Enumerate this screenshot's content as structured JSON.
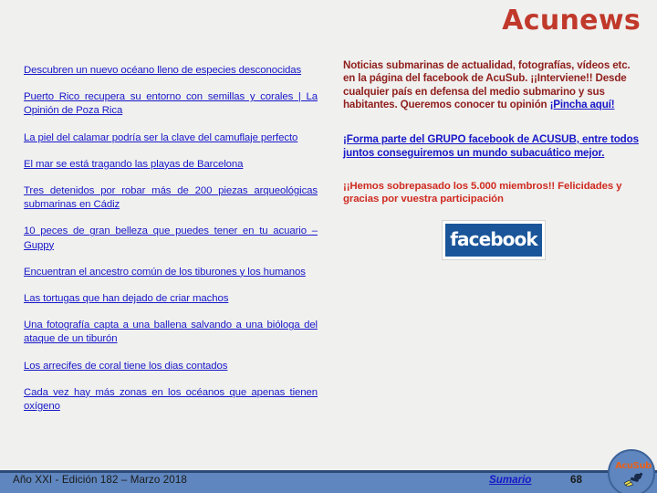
{
  "header": {
    "title": "Acunews",
    "title_color": "#c0392b"
  },
  "left_column": {
    "links": [
      {
        "text": "Descubren un nuevo océano lleno de especies desconocidas"
      },
      {
        "text": "Puerto Rico recupera su entorno con semillas y corales | La Opinión de Poza Rica"
      },
      {
        "text": "La piel del calamar podría ser la clave del camuflaje perfecto"
      },
      {
        "text": "El mar se está tragando las playas de Barcelona"
      },
      {
        "text": "Tres detenidos por robar más de 200 piezas arqueológicas submarinas en Cádiz"
      },
      {
        "text": "10 peces de gran belleza que puedes tener en tu acuario – Guppy"
      },
      {
        "text": "Encuentran el ancestro común de los tiburones y los humanos"
      },
      {
        "text": "Las tortugas que han dejado de criar machos"
      },
      {
        "text": "Una fotografía capta a una ballena salvando a una bióloga del ataque de un tiburón"
      },
      {
        "text": "Los arrecifes de coral tiene los dias contados"
      },
      {
        "text": "Cada vez hay más zonas en los océanos que apenas tienen oxígeno"
      }
    ],
    "link_color": "#1818c8"
  },
  "right_column": {
    "intro_text": "Noticias submarinas de actualidad, fotografías, vídeos etc. en la página del facebook de AcuSub. ¡¡Interviene!! Desde cualquier país en defensa del medio submarino y sus habitantes. Queremos conocer tu opinión ",
    "intro_link": "¡Pincha aquí!",
    "intro_color": "#8f1f1c",
    "group_link": "¡Forma parte del GRUPO facebook de ACUSUB, entre todos juntos conseguiremos un mundo subacuático mejor.",
    "members_text": "¡¡Hemos sobrepasado los 5.000 miembros!! Felicidades y gracias por vuestra participación",
    "members_color": "#cf2b20",
    "facebook_label": "facebook",
    "facebook_color": "#1a5599"
  },
  "footer": {
    "edition": "Año XXI - Edición 182 –  Marzo 2018",
    "sumario_label": "Sumario",
    "page_number": "68",
    "bar_color": "#5f86be",
    "logo_text": "AcuSub"
  }
}
